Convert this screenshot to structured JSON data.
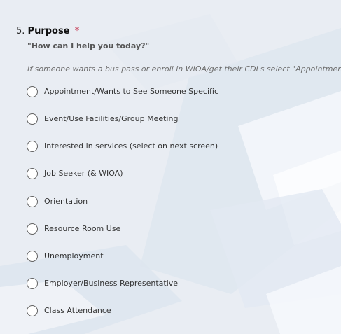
{
  "question": {
    "number": "5.",
    "title": "Purpose",
    "required_mark": "*",
    "subtitle": "\"How can I help you today?\"",
    "hint": "If someone wants a bus pass or enroll in WIOA/get their CDLs select \"Appointment\""
  },
  "options": [
    {
      "label": "Appointment/Wants to See Someone Specific",
      "selected": false
    },
    {
      "label": "Event/Use Facilities/Group Meeting",
      "selected": false
    },
    {
      "label": "Interested in services (select on next screen)",
      "selected": false
    },
    {
      "label": "Job Seeker (& WIOA)",
      "selected": false
    },
    {
      "label": "Orientation",
      "selected": false
    },
    {
      "label": "Resource Room Use",
      "selected": false
    },
    {
      "label": "Unemployment",
      "selected": false
    },
    {
      "label": "Employer/Business Representative",
      "selected": false
    },
    {
      "label": "Class Attendance",
      "selected": false
    }
  ],
  "colors": {
    "background": "#e8ecf2",
    "required": "#c4314b",
    "radio_border": "#616161"
  }
}
